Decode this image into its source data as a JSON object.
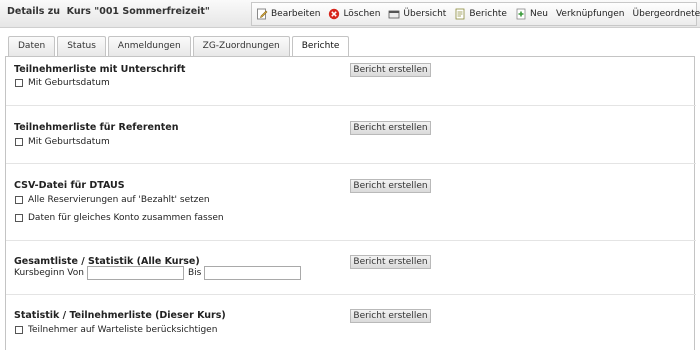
{
  "header": {
    "title": "Details zu  Kurs \"001 Sommerfreizeit\""
  },
  "toolbar": {
    "items": [
      {
        "label": "Bearbeiten",
        "icon": "edit-icon"
      },
      {
        "label": "Löschen",
        "icon": "delete-icon"
      },
      {
        "label": "Übersicht",
        "icon": "overview-icon"
      },
      {
        "label": "Berichte",
        "icon": "reports-icon"
      },
      {
        "label": "Neu",
        "icon": "new-icon"
      },
      {
        "label": "Verknüpfungen"
      },
      {
        "label": "Übergeordnete Daten"
      }
    ]
  },
  "tabs": [
    {
      "label": "Daten",
      "active": false
    },
    {
      "label": "Status",
      "active": false
    },
    {
      "label": "Anmeldungen",
      "active": false
    },
    {
      "label": "ZG-Zuordnungen",
      "active": false
    },
    {
      "label": "Berichte",
      "active": true
    }
  ],
  "report_button_label": "Bericht erstellen",
  "sections": [
    {
      "title": "Teilnehmerliste mit Unterschrift",
      "options": [
        "Mit Geburtsdatum"
      ]
    },
    {
      "title": "Teilnehmerliste für Referenten",
      "options": [
        "Mit Geburtsdatum"
      ]
    },
    {
      "title": "CSV-Datei für DTAUS",
      "options": [
        "Alle Reservierungen auf 'Bezahlt' setzen",
        "Daten für gleiches Konto zusammen fassen"
      ]
    },
    {
      "title": "Gesamtliste / Statistik (Alle Kurse)",
      "date_from_label": "Kursbeginn Von",
      "date_to_label": "Bis",
      "date_from_value": "",
      "date_to_value": ""
    },
    {
      "title": "Statistik / Teilnehmerliste (Dieser Kurs)",
      "options": [
        "Teilnehmer auf Warteliste berücksichtigen"
      ]
    }
  ],
  "colors": {
    "edit": "#7a7a7a",
    "delete": "#d7261c",
    "overview": "#555555",
    "reports": "#8a8a3a",
    "new": "#3a9a3a"
  }
}
